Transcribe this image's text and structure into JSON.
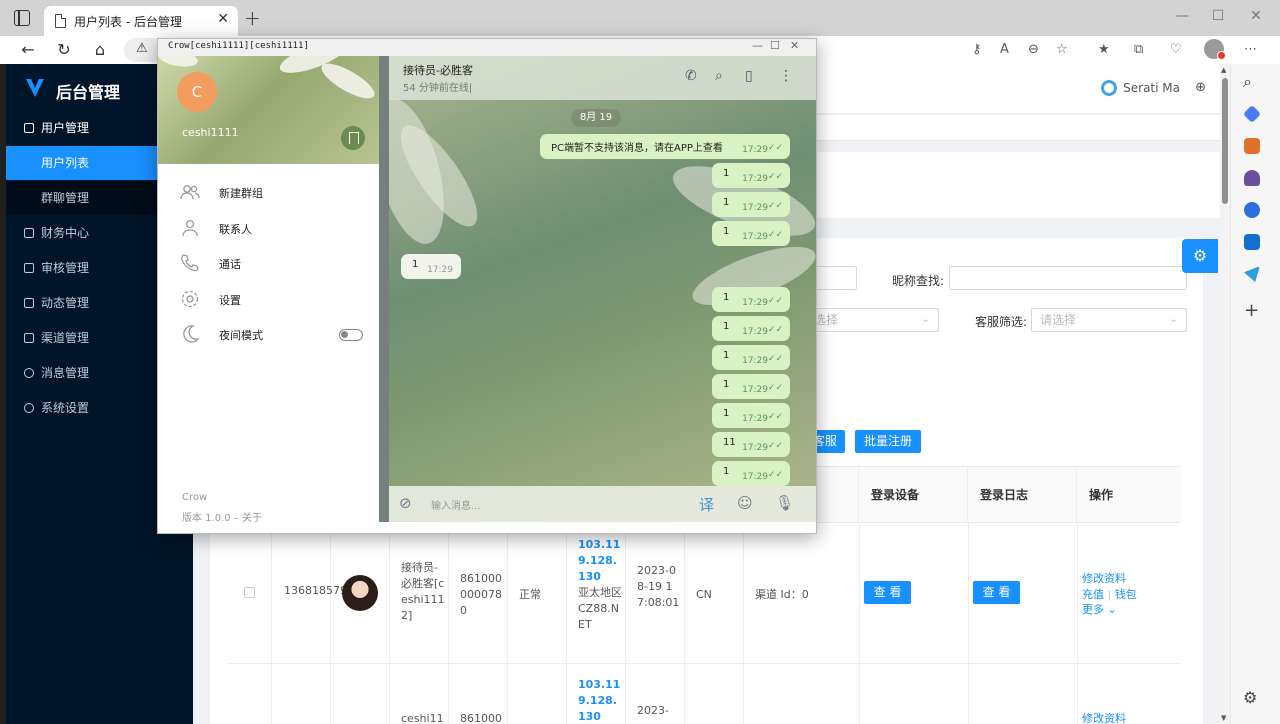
{
  "browser": {
    "tab_title": "用户列表 - 后台管理",
    "new_tab": "+",
    "tab_close": "✕",
    "window_controls": {
      "minimize": "—",
      "maximize": "☐",
      "close": "✕"
    },
    "profile_name": "Serati Ma"
  },
  "sidebar": {
    "brand": "后台管理",
    "items": [
      {
        "label": "用户管理",
        "type": "root"
      },
      {
        "label": "用户列表",
        "type": "sub-active"
      },
      {
        "label": "群聊管理",
        "type": "sub"
      },
      {
        "label": "财务中心",
        "type": "root-collapsed"
      },
      {
        "label": "审核管理",
        "type": "root-collapsed"
      },
      {
        "label": "动态管理",
        "type": "root-collapsed"
      },
      {
        "label": "渠道管理",
        "type": "root-collapsed"
      },
      {
        "label": "消息管理",
        "type": "root-collapsed"
      },
      {
        "label": "系统设置",
        "type": "root-collapsed"
      }
    ]
  },
  "filters": {
    "nickname_label": "昵称查找:",
    "service_label": "客服筛选:",
    "select_placeholder": "请选择",
    "select_placeholder_partial": "选择"
  },
  "buttons": {
    "service_partial": "客服",
    "batch_register": "批量注册"
  },
  "table": {
    "headers": {
      "login_device": "登录设备",
      "login_log": "登录日志",
      "action": "操作"
    },
    "rows": [
      {
        "id": "136818579",
        "nickname": "接待员-必胜客[ceshi1112]",
        "phone": "8610000000780",
        "status": "正常",
        "ip": "103.119.128.130",
        "region": "亚太地区CZ88.NET",
        "time": "2023-08-19 17:08:01",
        "country": "CN",
        "channel": "渠道 Id：0",
        "view_device": "查 看",
        "view_log": "查 看",
        "act_edit": "修改资料",
        "act_recharge": "充值",
        "act_wallet": "钱包",
        "act_more": "更多 ⌄"
      },
      {
        "nickname": "ceshi11",
        "phone": "861000",
        "ip": "103.119.128.130",
        "time": "2023-",
        "act_edit": "修改资料"
      }
    ]
  },
  "telegram": {
    "window_title": "Crow[ceshi1111][ceshi1111]",
    "avatar_letter": "C",
    "username": "ceshi1111",
    "menu": [
      {
        "label": "新建群组",
        "icon": "group-icon"
      },
      {
        "label": "联系人",
        "icon": "person-icon"
      },
      {
        "label": "通话",
        "icon": "phone-icon"
      },
      {
        "label": "设置",
        "icon": "gear-icon"
      },
      {
        "label": "夜间模式",
        "icon": "moon-icon"
      }
    ],
    "app_name": "Crow",
    "version": "版本 1.0.0 – 关于",
    "chat_name": "接待员-必胜客",
    "chat_status": "54 分钟前在线|",
    "date": "8月 19",
    "input_placeholder": "输入消息...",
    "translate": "译",
    "messages": [
      {
        "text": "PC端暂不支持该消息，请在APP上查看",
        "time": "17:29",
        "dir": "out"
      },
      {
        "text": "1",
        "time": "17:29",
        "dir": "out"
      },
      {
        "text": "1",
        "time": "17:29",
        "dir": "out"
      },
      {
        "text": "1",
        "time": "17:29",
        "dir": "out"
      },
      {
        "text": "1",
        "time": "17:29",
        "dir": "in"
      },
      {
        "text": "1",
        "time": "17:29",
        "dir": "out"
      },
      {
        "text": "1",
        "time": "17:29",
        "dir": "out"
      },
      {
        "text": "1",
        "time": "17:29",
        "dir": "out"
      },
      {
        "text": "1",
        "time": "17:29",
        "dir": "out"
      },
      {
        "text": "1",
        "time": "17:29",
        "dir": "out"
      },
      {
        "text": "11",
        "time": "17:29",
        "dir": "out"
      },
      {
        "text": "1",
        "time": "17:29",
        "dir": "out"
      }
    ],
    "check": "✓✓"
  }
}
